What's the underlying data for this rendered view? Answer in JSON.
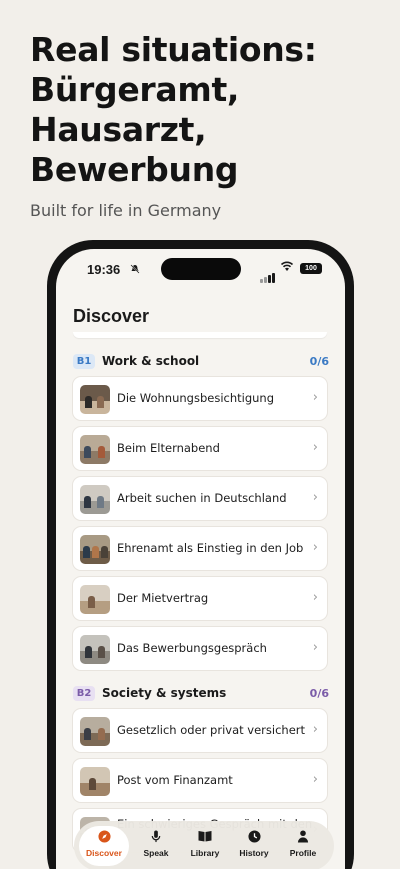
{
  "hero": {
    "title_lines": [
      "Real situations:",
      "Bürgeramt,",
      "Hausarzt,",
      "Bewerbung"
    ],
    "subtitle": "Built for life in Germany"
  },
  "status_bar": {
    "time": "19:36",
    "battery": "100",
    "icons": [
      "bell-muted-icon",
      "signal-icon",
      "wifi-icon",
      "battery-icon"
    ]
  },
  "page": {
    "title": "Discover"
  },
  "sections": [
    {
      "level": "B1",
      "title": "Work & school",
      "count": "0/6",
      "accent": "#3b7ac4",
      "badge_bg": "#dce8f6",
      "items": [
        {
          "label": "Die Wohnungsbesichtigung"
        },
        {
          "label": "Beim Elternabend"
        },
        {
          "label": "Arbeit suchen in Deutschland"
        },
        {
          "label": "Ehrenamt als Einstieg in den Job"
        },
        {
          "label": "Der Mietvertrag"
        },
        {
          "label": "Das Bewerbungsgespräch"
        }
      ]
    },
    {
      "level": "B2",
      "title": "Society & systems",
      "count": "0/6",
      "accent": "#7b5ca8",
      "badge_bg": "#e8e0f2",
      "items": [
        {
          "label": "Gesetzlich oder privat versichert"
        },
        {
          "label": "Post vom Finanzamt"
        },
        {
          "label": "Ein schwieriges Gespräch mit den"
        }
      ]
    }
  ],
  "tabbar": {
    "active": "Discover",
    "active_color": "#d9551a",
    "tabs": [
      {
        "label": "Discover",
        "icon": "compass-icon"
      },
      {
        "label": "Speak",
        "icon": "microphone-icon"
      },
      {
        "label": "Library",
        "icon": "book-icon"
      },
      {
        "label": "History",
        "icon": "clock-icon"
      },
      {
        "label": "Profile",
        "icon": "person-icon"
      }
    ]
  }
}
